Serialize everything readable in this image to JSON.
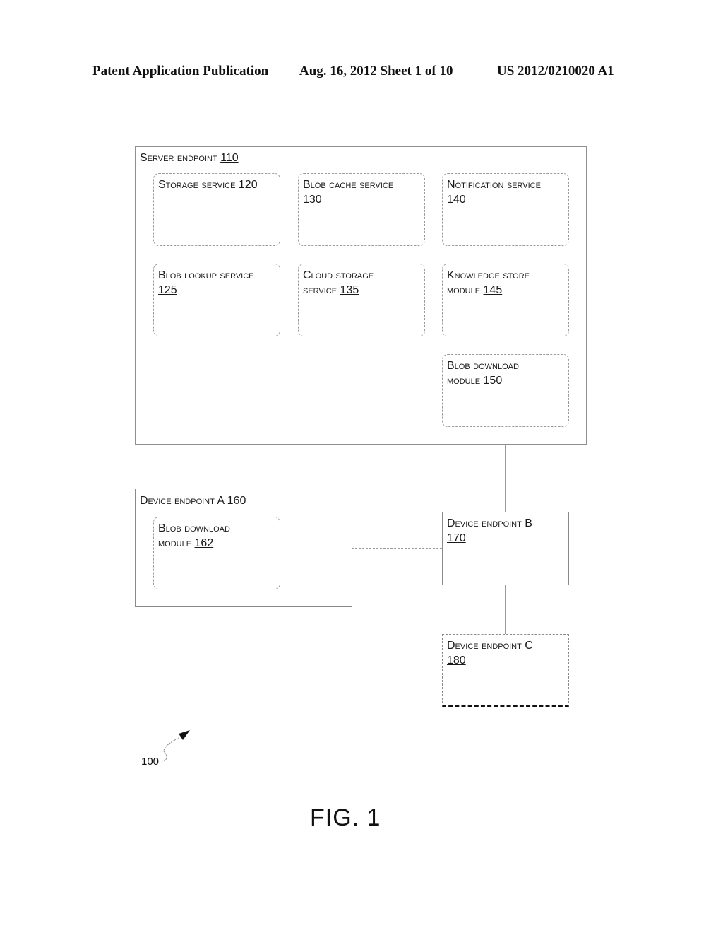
{
  "header": {
    "publication": "Patent Application Publication",
    "date_sheet": "Aug. 16, 2012  Sheet 1 of 10",
    "number": "US 2012/0210020 A1"
  },
  "diagram": {
    "server": {
      "label": "Server endpoint ",
      "num": "110"
    },
    "storage_service": {
      "label": "Storage service ",
      "num": "120"
    },
    "blob_cache_service": {
      "label": "Blob cache service",
      "num": "130"
    },
    "notification_service": {
      "label": "Notification service",
      "num": "140"
    },
    "blob_lookup_service": {
      "label": "Blob lookup service",
      "num": "125"
    },
    "cloud_storage_service": {
      "label1": "Cloud storage",
      "label2": "service ",
      "num": "135"
    },
    "knowledge_store_module": {
      "label1": "Knowledge store",
      "label2": "module ",
      "num": "145"
    },
    "blob_download_module_150": {
      "label1": "Blob download",
      "label2": "module ",
      "num": "150"
    },
    "device_a": {
      "label": "Device endpoint A ",
      "num": "160"
    },
    "blob_download_module_162": {
      "label1": "Blob download",
      "label2": "module ",
      "num": "162"
    },
    "device_b": {
      "label": "Device endpoint B",
      "num": "170"
    },
    "device_c": {
      "label": "Device endpoint C",
      "num": "180"
    }
  },
  "reference_numeral": "100",
  "figure_label": "FIG. 1"
}
